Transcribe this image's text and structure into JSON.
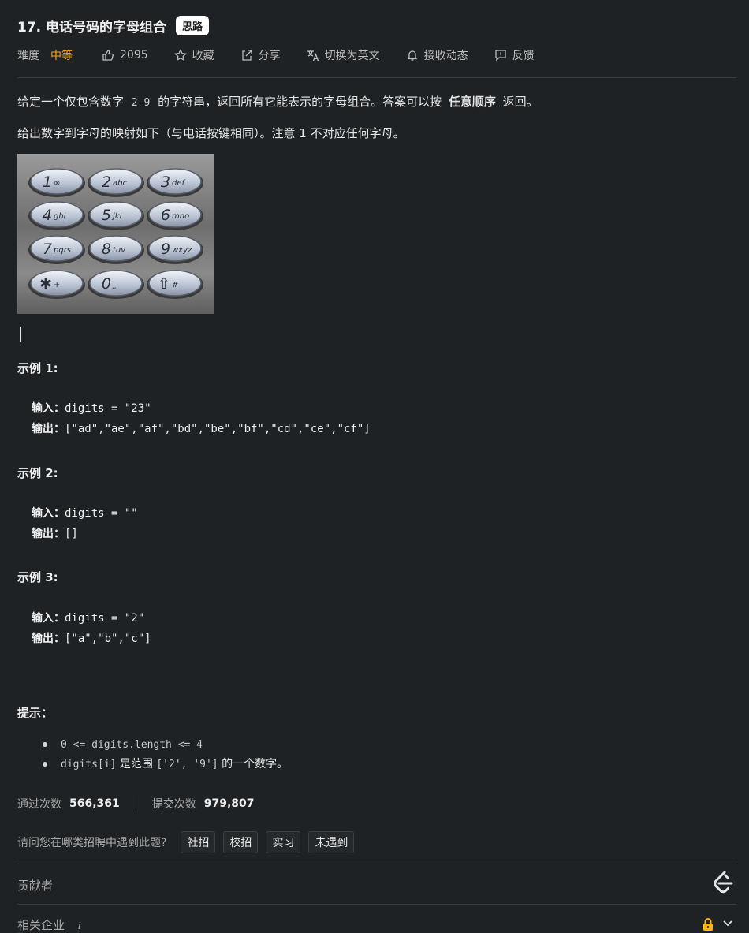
{
  "header": {
    "title": "17. 电话号码的字母组合",
    "badge": "思路"
  },
  "meta": {
    "difficulty_label": "难度",
    "difficulty_value": "中等",
    "likes": "2095",
    "favorite": "收藏",
    "share": "分享",
    "switch_lang": "切换为英文",
    "subscribe": "接收动态",
    "feedback": "反馈"
  },
  "description": {
    "p1_pre": "给定一个仅包含数字",
    "p1_code": "2-9",
    "p1_mid": "的字符串，返回所有它能表示的字母组合。答案可以按",
    "p1_bold": "任意顺序",
    "p1_post": "返回。",
    "p2": "给出数字到字母的映射如下（与电话按键相同）。注意 1 不对应任何字母。"
  },
  "keypad": [
    [
      "1",
      "∞"
    ],
    [
      "2",
      "abc"
    ],
    [
      "3",
      "def"
    ],
    [
      "4",
      "ghi"
    ],
    [
      "5",
      "jkl"
    ],
    [
      "6",
      "mno"
    ],
    [
      "7",
      "pqrs"
    ],
    [
      "8",
      "tuv"
    ],
    [
      "9",
      "wxyz"
    ],
    [
      "✱",
      "+"
    ],
    [
      "0",
      "⎵"
    ],
    [
      "⇧",
      "#"
    ]
  ],
  "examples": [
    {
      "title": "示例 1:",
      "input_label": "输入：",
      "input": "digits = \"23\"",
      "output_label": "输出：",
      "output": "[\"ad\",\"ae\",\"af\",\"bd\",\"be\",\"bf\",\"cd\",\"ce\",\"cf\"]"
    },
    {
      "title": "示例 2:",
      "input_label": "输入：",
      "input": "digits = \"\"",
      "output_label": "输出：",
      "output": "[]"
    },
    {
      "title": "示例 3:",
      "input_label": "输入：",
      "input": "digits = \"2\"",
      "output_label": "输出：",
      "output": "[\"a\",\"b\",\"c\"]"
    }
  ],
  "tips": {
    "title": "提示：",
    "item1": "0 <= digits.length <= 4",
    "item2_code1": "digits[i]",
    "item2_text1": "是范围",
    "item2_code2": "['2', '9']",
    "item2_text2": "的一个数字。"
  },
  "stats": {
    "accepted_label": "通过次数",
    "accepted_value": "566,361",
    "submitted_label": "提交次数",
    "submitted_value": "979,807"
  },
  "recruit": {
    "question": "请问您在哪类招聘中遇到此题?",
    "options": [
      "社招",
      "校招",
      "实习",
      "未遇到"
    ]
  },
  "sections": {
    "contributors": "贡献者",
    "companies": "相关企业",
    "info": "i"
  },
  "colors": {
    "background": "#1f2224",
    "difficulty": "#ffa116",
    "lock": "#ffb800"
  }
}
